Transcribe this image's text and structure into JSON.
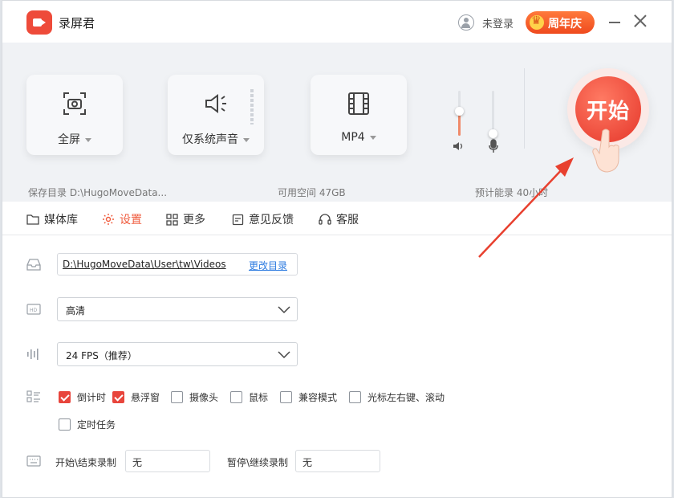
{
  "app": {
    "title": "录屏君",
    "login_text": "未登录",
    "anniversary_badge": "周年庆"
  },
  "capture": {
    "mode_label": "全屏",
    "audio_label": "仅系统声音",
    "format_label": "MP4",
    "start_label": "开始",
    "speaker_volume": 0.55,
    "mic_volume": 0.0
  },
  "info": {
    "save_dir": "保存目录   D:\\HugoMoveData...",
    "free_space": "可用空间   47GB",
    "est_duration": "预计能录   40小时"
  },
  "nav": {
    "media": "媒体库",
    "settings": "设置",
    "more": "更多",
    "feedback": "意见反馈",
    "service": "客服"
  },
  "settings": {
    "directory": "D:\\HugoMoveData\\User\\tw\\Videos",
    "change_dir": "更改目录",
    "quality": "高清",
    "fps": "24 FPS（推荐）",
    "options": [
      {
        "label": "倒计时",
        "checked": true
      },
      {
        "label": "悬浮窗",
        "checked": true
      },
      {
        "label": "摄像头",
        "checked": false
      },
      {
        "label": "鼠标",
        "checked": false
      },
      {
        "label": "兼容模式",
        "checked": false
      },
      {
        "label": "光标左右键、滚动",
        "checked": false
      },
      {
        "label": "定时任务",
        "checked": false
      }
    ],
    "hotkey_start_label": "开始\\结束录制",
    "hotkey_start_value": "无",
    "hotkey_pause_label": "暂停\\继续录制",
    "hotkey_pause_value": "无"
  },
  "colors": {
    "accent": "#ef5a3c",
    "start_button": "#e5362a",
    "link": "#2d7be0",
    "checkbox_checked": "#e8453c",
    "panel_bg": "#f0f2f5"
  }
}
